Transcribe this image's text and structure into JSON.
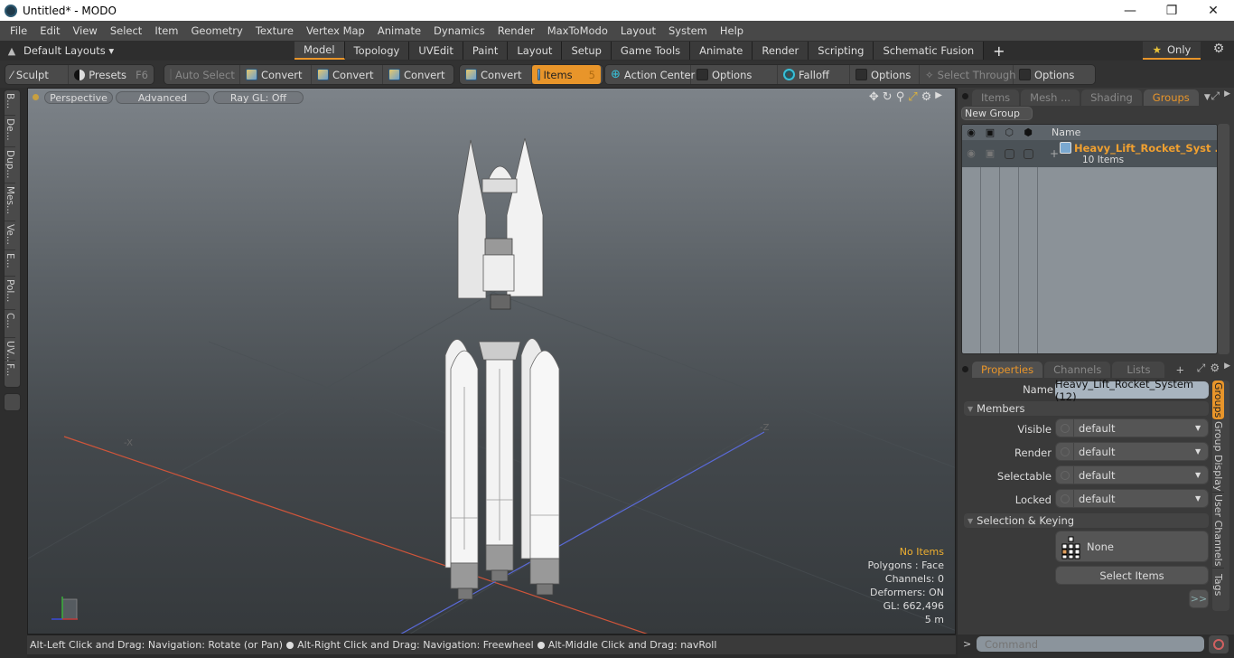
{
  "window": {
    "title": "Untitled* - MODO",
    "controls": [
      "minimize",
      "maximize",
      "close"
    ]
  },
  "menubar": [
    "File",
    "Edit",
    "View",
    "Select",
    "Item",
    "Geometry",
    "Texture",
    "Vertex Map",
    "Animate",
    "Dynamics",
    "Render",
    "MaxToModo",
    "Layout",
    "System",
    "Help"
  ],
  "layoutbar": {
    "layouts_label": "Default Layouts ▾",
    "tabs": [
      "Model",
      "Topology",
      "UVEdit",
      "Paint",
      "Layout",
      "Setup",
      "Game Tools",
      "Animate",
      "Render",
      "Scripting",
      "Schematic Fusion"
    ],
    "active_tab": "Model",
    "add_tab": "+",
    "only_label": "Only"
  },
  "toolbar": {
    "sculpt": "Sculpt",
    "presets": "Presets",
    "presets_key": "F6",
    "auto_select": "Auto Select",
    "convert1": "Convert",
    "convert2": "Convert",
    "convert3": "Convert",
    "convert4": "Convert",
    "items": "Items",
    "items_key": "5",
    "action_center": "Action Center",
    "options1": "Options",
    "falloff": "Falloff",
    "options2": "Options",
    "select_through": "Select Through",
    "options3": "Options"
  },
  "left_strip": [
    "B...",
    "De...",
    "Dup...",
    "Mes...",
    "Ve...",
    "E...",
    "Pol...",
    "C...",
    "UV...",
    "F..."
  ],
  "viewport": {
    "view_mode": "Perspective",
    "shading": "Advanced",
    "raygl": "Ray GL: Off",
    "hud": {
      "selection": "No Items",
      "polygons": "Polygons : Face",
      "channels": "Channels: 0",
      "deformers": "Deformers: ON",
      "gl": "GL: 662,496",
      "scale": "5 m"
    },
    "axis_labels": {
      "x_neg": "-X",
      "z_neg": "-Z"
    }
  },
  "statusbar": {
    "hint1": "Alt-Left Click and Drag: Navigation: Rotate (or Pan)",
    "hint2": "Alt-Right Click and Drag: Navigation: Freewheel",
    "hint3": "Alt-Middle Click and Drag: navRoll"
  },
  "groups_panel": {
    "tabs": [
      "Items",
      "Mesh ...",
      "Shading",
      "Groups"
    ],
    "active_tab": "Groups",
    "new_group": "New Group",
    "column_name": "Name",
    "rows": [
      {
        "name": "Heavy_Lift_Rocket_Syst ...",
        "count": "10 Items"
      }
    ]
  },
  "properties_panel": {
    "tabs": [
      "Properties",
      "Channels",
      "Lists"
    ],
    "active_tab": "Properties",
    "add_tab": "+",
    "name_label": "Name",
    "name_value": "Heavy_Lift_Rocket_System (12)",
    "members_section": "Members",
    "fields": [
      {
        "label": "Visible",
        "value": "default"
      },
      {
        "label": "Render",
        "value": "default"
      },
      {
        "label": "Selectable",
        "value": "default"
      },
      {
        "label": "Locked",
        "value": "default"
      }
    ],
    "keying_section": "Selection & Keying",
    "none_label": "None",
    "select_items": "Select Items",
    "more": ">>",
    "side_tabs": [
      "Groups",
      "Group Display",
      "User Channels",
      "Tags"
    ],
    "active_side_tab": "Groups"
  },
  "command": {
    "prompt": ">",
    "placeholder": "Command"
  },
  "colors": {
    "accent": "#e8952a",
    "group_name": "#f0a030",
    "hud_highlight": "#f0b030"
  }
}
